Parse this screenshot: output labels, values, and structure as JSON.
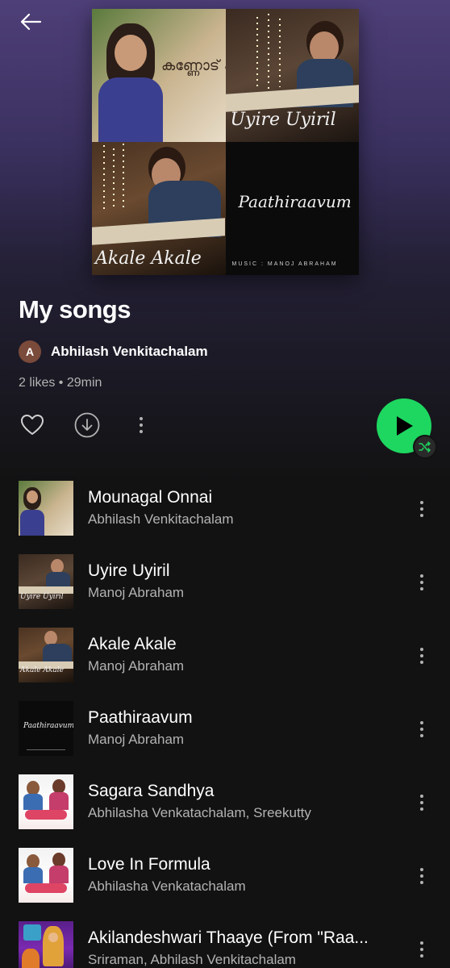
{
  "playlist": {
    "title": "My songs",
    "owner": {
      "initial": "A",
      "name": "Abhilash Venkitachalam"
    },
    "meta": "2 likes • 29min",
    "cover": {
      "tile1_title": "കണ്ണോട് കണ്ണോരം",
      "tile2_title": "Uyire Uyiril",
      "tile3_title": "Akale Akale",
      "tile4_title": "Paathiraavum",
      "music_credit": "MUSIC : MANOJ ABRAHAM"
    }
  },
  "colors": {
    "accent": "#1ed760",
    "background": "#121212",
    "header": "#4e3f78"
  },
  "tracks": [
    {
      "title": "Mounagal Onnai",
      "artist": "Abhilash Venkitachalam",
      "thumb": "tile1"
    },
    {
      "title": "Uyire Uyiril",
      "artist": "Manoj Abraham",
      "thumb": "tile2",
      "thumb_text": "Uyire Uyiril"
    },
    {
      "title": "Akale Akale",
      "artist": "Manoj Abraham",
      "thumb": "tile3",
      "thumb_text": "Akale Akale"
    },
    {
      "title": "Paathiraavum",
      "artist": "Manoj Abraham",
      "thumb": "tile4",
      "thumb_text": "Paathiraavum"
    },
    {
      "title": "Sagara Sandhya",
      "artist": "Abhilasha Venkatachalam, Sreekutty",
      "thumb": "poster"
    },
    {
      "title": "Love In Formula",
      "artist": "Abhilasha Venkatachalam",
      "thumb": "poster"
    },
    {
      "title": "Akilandeshwari Thaaye (From \"Raa...",
      "artist": "Sriraman, Abhilash Venkitachalam",
      "thumb": "devotional"
    }
  ]
}
